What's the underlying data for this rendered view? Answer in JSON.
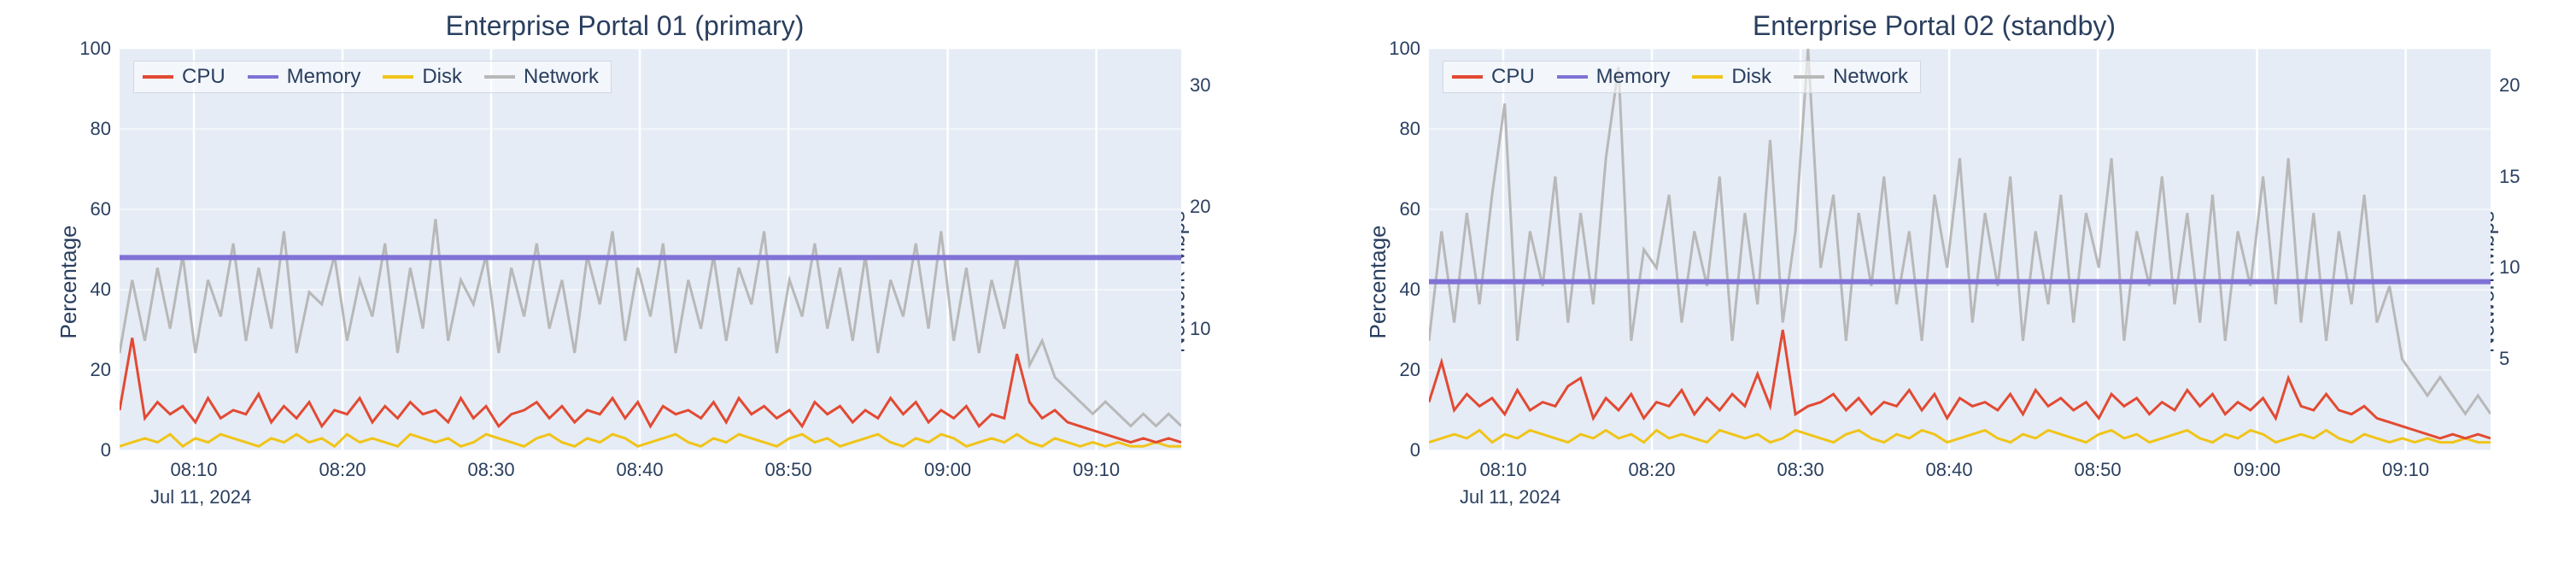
{
  "chart_data": [
    {
      "type": "line",
      "title": "Enterprise Portal 01 (primary)",
      "ylabel_left": "Percentage",
      "ylabel_right": "Network Mbps",
      "ylim_left": [
        0,
        100
      ],
      "ylim_right": [
        0,
        33
      ],
      "yticks_left": [
        0,
        20,
        40,
        60,
        80,
        100
      ],
      "yticks_right": [
        10,
        20,
        30
      ],
      "xticks": [
        "08:10",
        "08:20",
        "08:30",
        "08:40",
        "08:50",
        "09:00",
        "09:10"
      ],
      "xtick_pct": [
        7,
        21,
        35,
        49,
        63,
        78,
        92
      ],
      "date_label": "Jul 11, 2024",
      "legend": [
        {
          "name": "CPU",
          "color": "#e24a33"
        },
        {
          "name": "Memory",
          "color": "#8072d6"
        },
        {
          "name": "Disk",
          "color": "#f0c419"
        },
        {
          "name": "Network",
          "color": "#b8b8b8"
        }
      ],
      "series": [
        {
          "name": "CPU",
          "axis": "left",
          "color": "#e24a33",
          "y": [
            10,
            28,
            8,
            12,
            9,
            11,
            7,
            13,
            8,
            10,
            9,
            14,
            7,
            11,
            8,
            12,
            6,
            10,
            9,
            13,
            7,
            11,
            8,
            12,
            9,
            10,
            7,
            13,
            8,
            11,
            6,
            9,
            10,
            12,
            8,
            11,
            7,
            10,
            9,
            13,
            8,
            12,
            6,
            11,
            9,
            10,
            8,
            12,
            7,
            13,
            9,
            11,
            8,
            10,
            6,
            12,
            9,
            11,
            7,
            10,
            8,
            13,
            9,
            12,
            7,
            10,
            8,
            11,
            6,
            9,
            8,
            24,
            12,
            8,
            10,
            7,
            6,
            5,
            4,
            3,
            2,
            3,
            2,
            3,
            2
          ]
        },
        {
          "name": "Memory",
          "axis": "left",
          "color": "#8072d6",
          "y": [
            48,
            48,
            48,
            48,
            48,
            48,
            48,
            48,
            48,
            48,
            48,
            48,
            48,
            48,
            48,
            48,
            48,
            48,
            48,
            48,
            48,
            48,
            48,
            48,
            48,
            48,
            48,
            48,
            48,
            48,
            48,
            48,
            48,
            48,
            48,
            48,
            48,
            48,
            48,
            48,
            48,
            48,
            48,
            48,
            48,
            48,
            48,
            48,
            48,
            48,
            48,
            48,
            48,
            48,
            48,
            48,
            48,
            48,
            48,
            48,
            48,
            48,
            48,
            48,
            48,
            48,
            48,
            48,
            48,
            48,
            48,
            48,
            48,
            48,
            48,
            48,
            48,
            48,
            48,
            48,
            48,
            48,
            48,
            48,
            48
          ]
        },
        {
          "name": "Disk",
          "axis": "left",
          "color": "#f0c419",
          "y": [
            1,
            2,
            3,
            2,
            4,
            1,
            3,
            2,
            4,
            3,
            2,
            1,
            3,
            2,
            4,
            2,
            3,
            1,
            4,
            2,
            3,
            2,
            1,
            4,
            3,
            2,
            3,
            1,
            2,
            4,
            3,
            2,
            1,
            3,
            4,
            2,
            1,
            3,
            2,
            4,
            3,
            1,
            2,
            3,
            4,
            2,
            1,
            3,
            2,
            4,
            3,
            2,
            1,
            3,
            4,
            2,
            3,
            1,
            2,
            3,
            4,
            2,
            1,
            3,
            2,
            4,
            3,
            1,
            2,
            3,
            2,
            4,
            2,
            1,
            3,
            2,
            1,
            2,
            1,
            2,
            1,
            1,
            2,
            1,
            1
          ]
        },
        {
          "name": "Network",
          "axis": "right",
          "color": "#b8b8b8",
          "y": [
            8,
            14,
            9,
            15,
            10,
            16,
            8,
            14,
            11,
            17,
            9,
            15,
            10,
            18,
            8,
            13,
            12,
            16,
            9,
            14,
            11,
            17,
            8,
            15,
            10,
            19,
            9,
            14,
            12,
            16,
            8,
            15,
            11,
            17,
            10,
            14,
            8,
            16,
            12,
            18,
            9,
            15,
            11,
            17,
            8,
            14,
            10,
            16,
            9,
            15,
            12,
            18,
            8,
            14,
            11,
            17,
            10,
            15,
            9,
            16,
            8,
            14,
            11,
            17,
            10,
            18,
            9,
            15,
            8,
            14,
            10,
            16,
            7,
            9,
            6,
            5,
            4,
            3,
            4,
            3,
            2,
            3,
            2,
            3,
            2
          ]
        }
      ]
    },
    {
      "type": "line",
      "title": "Enterprise Portal 02 (standby)",
      "ylabel_left": "Percentage",
      "ylabel_right": "Network Mbps",
      "ylim_left": [
        0,
        100
      ],
      "ylim_right": [
        0,
        22
      ],
      "yticks_left": [
        0,
        20,
        40,
        60,
        80,
        100
      ],
      "yticks_right": [
        5,
        10,
        15,
        20
      ],
      "xticks": [
        "08:10",
        "08:20",
        "08:30",
        "08:40",
        "08:50",
        "09:00",
        "09:10"
      ],
      "xtick_pct": [
        7,
        21,
        35,
        49,
        63,
        78,
        92
      ],
      "date_label": "Jul 11, 2024",
      "legend": [
        {
          "name": "CPU",
          "color": "#e24a33"
        },
        {
          "name": "Memory",
          "color": "#8072d6"
        },
        {
          "name": "Disk",
          "color": "#f0c419"
        },
        {
          "name": "Network",
          "color": "#b8b8b8"
        }
      ],
      "series": [
        {
          "name": "CPU",
          "axis": "left",
          "color": "#e24a33",
          "y": [
            12,
            22,
            10,
            14,
            11,
            13,
            9,
            15,
            10,
            12,
            11,
            16,
            18,
            8,
            13,
            10,
            14,
            8,
            12,
            11,
            15,
            9,
            13,
            10,
            14,
            11,
            19,
            11,
            30,
            9,
            11,
            12,
            14,
            10,
            13,
            9,
            12,
            11,
            15,
            10,
            14,
            8,
            13,
            11,
            12,
            10,
            14,
            9,
            15,
            11,
            13,
            10,
            12,
            8,
            14,
            11,
            13,
            9,
            12,
            10,
            15,
            11,
            14,
            9,
            12,
            10,
            13,
            8,
            18,
            11,
            10,
            14,
            10,
            9,
            11,
            8,
            7,
            6,
            5,
            4,
            3,
            4,
            3,
            4,
            3
          ]
        },
        {
          "name": "Memory",
          "axis": "left",
          "color": "#8072d6",
          "y": [
            42,
            42,
            42,
            42,
            42,
            42,
            42,
            42,
            42,
            42,
            42,
            42,
            42,
            42,
            42,
            42,
            42,
            42,
            42,
            42,
            42,
            42,
            42,
            42,
            42,
            42,
            42,
            42,
            42,
            42,
            42,
            42,
            42,
            42,
            42,
            42,
            42,
            42,
            42,
            42,
            42,
            42,
            42,
            42,
            42,
            42,
            42,
            42,
            42,
            42,
            42,
            42,
            42,
            42,
            42,
            42,
            42,
            42,
            42,
            42,
            42,
            42,
            42,
            42,
            42,
            42,
            42,
            42,
            42,
            42,
            42,
            42,
            42,
            42,
            42,
            42,
            42,
            42,
            42,
            42,
            42,
            42,
            42,
            42,
            42
          ]
        },
        {
          "name": "Disk",
          "axis": "left",
          "color": "#f0c419",
          "y": [
            2,
            3,
            4,
            3,
            5,
            2,
            4,
            3,
            5,
            4,
            3,
            2,
            4,
            3,
            5,
            3,
            4,
            2,
            5,
            3,
            4,
            3,
            2,
            5,
            4,
            3,
            4,
            2,
            3,
            5,
            4,
            3,
            2,
            4,
            5,
            3,
            2,
            4,
            3,
            5,
            4,
            2,
            3,
            4,
            5,
            3,
            2,
            4,
            3,
            5,
            4,
            3,
            2,
            4,
            5,
            3,
            4,
            2,
            3,
            4,
            5,
            3,
            2,
            4,
            3,
            5,
            4,
            2,
            3,
            4,
            3,
            5,
            3,
            2,
            4,
            3,
            2,
            3,
            2,
            3,
            2,
            2,
            3,
            2,
            2
          ]
        },
        {
          "name": "Network",
          "axis": "right",
          "color": "#b8b8b8",
          "y": [
            6,
            12,
            7,
            13,
            8,
            14,
            19,
            6,
            12,
            9,
            15,
            7,
            13,
            8,
            16,
            21,
            6,
            11,
            10,
            14,
            7,
            12,
            9,
            15,
            6,
            13,
            8,
            17,
            7,
            12,
            22,
            10,
            14,
            6,
            13,
            9,
            15,
            8,
            12,
            6,
            14,
            10,
            16,
            7,
            13,
            9,
            15,
            6,
            12,
            8,
            14,
            7,
            13,
            10,
            16,
            6,
            12,
            9,
            15,
            8,
            13,
            7,
            14,
            6,
            12,
            9,
            15,
            8,
            16,
            7,
            13,
            6,
            12,
            8,
            14,
            7,
            9,
            5,
            4,
            3,
            4,
            3,
            2,
            3,
            2
          ]
        }
      ]
    }
  ]
}
